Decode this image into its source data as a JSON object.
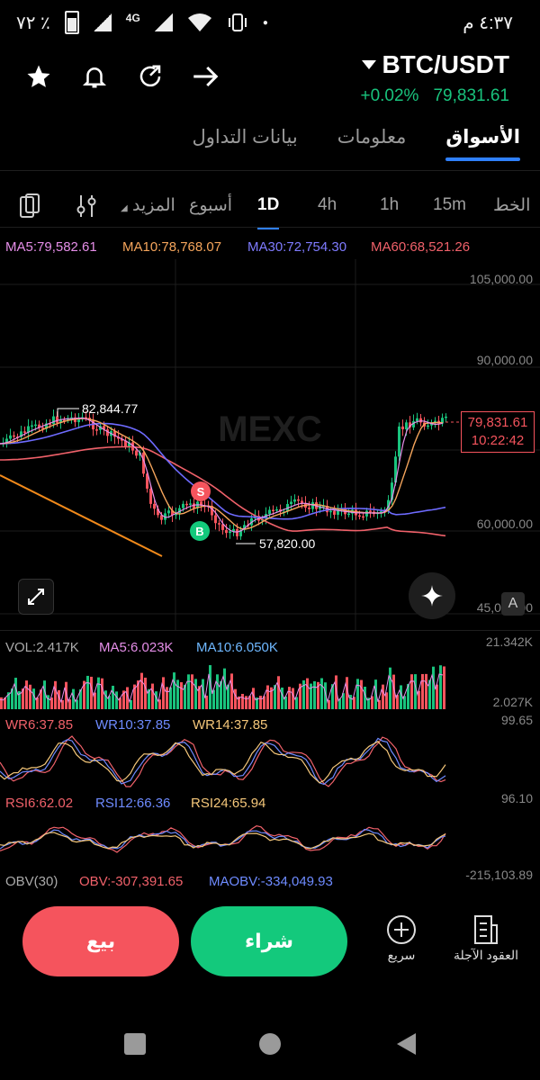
{
  "status": {
    "time": "٤:٣٧ م",
    "battery": "٧٢ ٪",
    "network": "4G"
  },
  "header": {
    "pair": "BTC/USDT",
    "change": "+0.02%",
    "price": "79,831.61",
    "colors": {
      "up": "#19c37d",
      "down": "#f5545d",
      "accent": "#2f80ff"
    }
  },
  "main_tabs": [
    {
      "label": "الأسواق",
      "active": true
    },
    {
      "label": "معلومات",
      "active": false
    },
    {
      "label": "بيانات التداول",
      "active": false
    }
  ],
  "intervals": {
    "line": "الخط",
    "m15": "15m",
    "h1": "1h",
    "h4": "4h",
    "d1": "1D",
    "week": "أسبوع",
    "more": "المزيد"
  },
  "ma_legend": {
    "ma5": "MA5:79,582.61",
    "ma10": "MA10:78,768.07",
    "ma30": "MA30:72,754.30",
    "ma60": "MA60:68,521.26"
  },
  "price_axis": {
    "t1": "105,000.00",
    "t2": "90,000.00",
    "t3": "60,000.00",
    "t4": "45,000.00"
  },
  "chart_marks": {
    "high": "82,844.77",
    "low": "57,820.00",
    "sell_marker": "S",
    "buy_marker": "B",
    "current_price": "79,831.61",
    "countdown": "10:22:42",
    "watermark": "MEXC",
    "font_button": "A"
  },
  "volume": {
    "vol": "VOL:2.417K",
    "ma5": "MA5:6.023K",
    "ma10": "MA10:6.050K",
    "axis_top": "21.342K",
    "axis_bottom": "2.027K"
  },
  "wr": {
    "wr6": "WR6:37.85",
    "wr10": "WR10:37.85",
    "wr14": "WR14:37.85",
    "axis": "99.65"
  },
  "rsi": {
    "rsi6": "RSI6:62.02",
    "rsi12": "RSI12:66.36",
    "rsi24": "RSI24:65.94",
    "axis": "96.10"
  },
  "obv": {
    "label": "OBV(30)",
    "obv": "OBV:-307,391.65",
    "maobv": "MAOBV:-334,049.93",
    "axis": "-215,103.89"
  },
  "bottom": {
    "sell": "بيع",
    "buy": "شراء",
    "quick": "سريع",
    "futures": "العقود الآجلة"
  }
}
